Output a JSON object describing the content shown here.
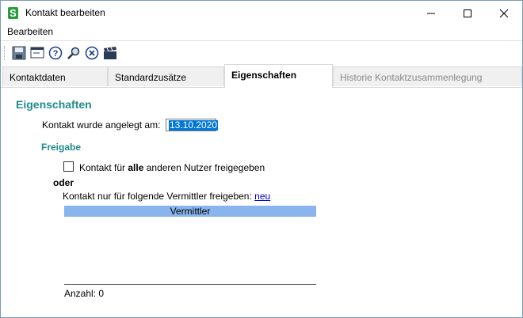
{
  "window": {
    "title": "Kontakt bearbeiten",
    "app_icon_letter": "S"
  },
  "menu": {
    "items": [
      "Bearbeiten"
    ]
  },
  "toolbar": {
    "buttons": [
      "save-icon",
      "window-icon",
      "help-icon",
      "search-icon",
      "cancel-icon",
      "clapper-icon"
    ]
  },
  "tabs": [
    {
      "label": "Kontaktdaten"
    },
    {
      "label": "Standardzusätze"
    },
    {
      "label": "Eigenschaften",
      "active": true
    },
    {
      "label": "Historie Kontaktzusammenlegung",
      "disabled": true
    }
  ],
  "properties": {
    "title": "Eigenschaften",
    "created_label": "Kontakt wurde angelegt am:",
    "created_value": "13.10.2020",
    "release_title": "Freigabe",
    "share_all_prefix": "Kontakt für",
    "share_all_bold": "alle",
    "share_all_suffix": "anderen Nutzer freigegeben",
    "share_all_checked": false,
    "or_label": "oder",
    "share_specific_label": "Kontakt nur für folgende Vermittler freigeben:",
    "new_link": "neu",
    "grid_header": "Vermittler",
    "count_label": "Anzahl: 0"
  }
}
